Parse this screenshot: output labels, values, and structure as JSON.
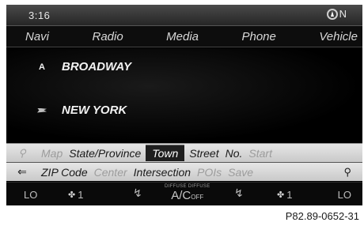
{
  "status": {
    "time": "3:16",
    "compass_heading": "N"
  },
  "menu": [
    "Navi",
    "Radio",
    "Media",
    "Phone",
    "Vehicle"
  ],
  "entries": [
    {
      "icon": "a-marker-icon",
      "icon_text": "A",
      "text": "BROADWAY"
    },
    {
      "icon": "flag-icon",
      "icon_text": "",
      "text": "NEW YORK"
    }
  ],
  "keys_row1": [
    {
      "label": "Map",
      "state": "disabled"
    },
    {
      "label": "State/Province",
      "state": "enabled"
    },
    {
      "label": "Town",
      "state": "selected"
    },
    {
      "label": "Street",
      "state": "enabled"
    },
    {
      "label": "No.",
      "state": "enabled"
    },
    {
      "label": "Start",
      "state": "disabled"
    }
  ],
  "keys_row2": [
    {
      "label": "ZIP Code",
      "state": "enabled"
    },
    {
      "label": "Center",
      "state": "disabled"
    },
    {
      "label": "Intersection",
      "state": "enabled"
    },
    {
      "label": "POIs",
      "state": "disabled"
    },
    {
      "label": "Save",
      "state": "disabled"
    }
  ],
  "climate": {
    "left_temp": "LO",
    "right_temp": "LO",
    "fan_left": "1",
    "fan_right": "1",
    "diffuse_text": "DIFFUSE DIFFUSE",
    "ac_label": "A/C",
    "ac_state": "OFF"
  },
  "caption": "P82.89-0652-31"
}
